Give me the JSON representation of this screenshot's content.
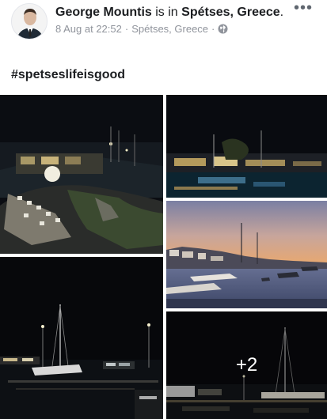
{
  "post": {
    "author": "George Mountis",
    "is_in": "is in",
    "place": "Spétses, Greece",
    "period": ".",
    "timestamp": "8 Aug at 22:52",
    "separator1": "·",
    "location": "Spétses, Greece",
    "separator2": "·",
    "privacy_icon": "globe-icon",
    "more_icon": "•••",
    "hashtag": "#spetseslifeisgood"
  },
  "photos": {
    "more_count": "+2"
  }
}
